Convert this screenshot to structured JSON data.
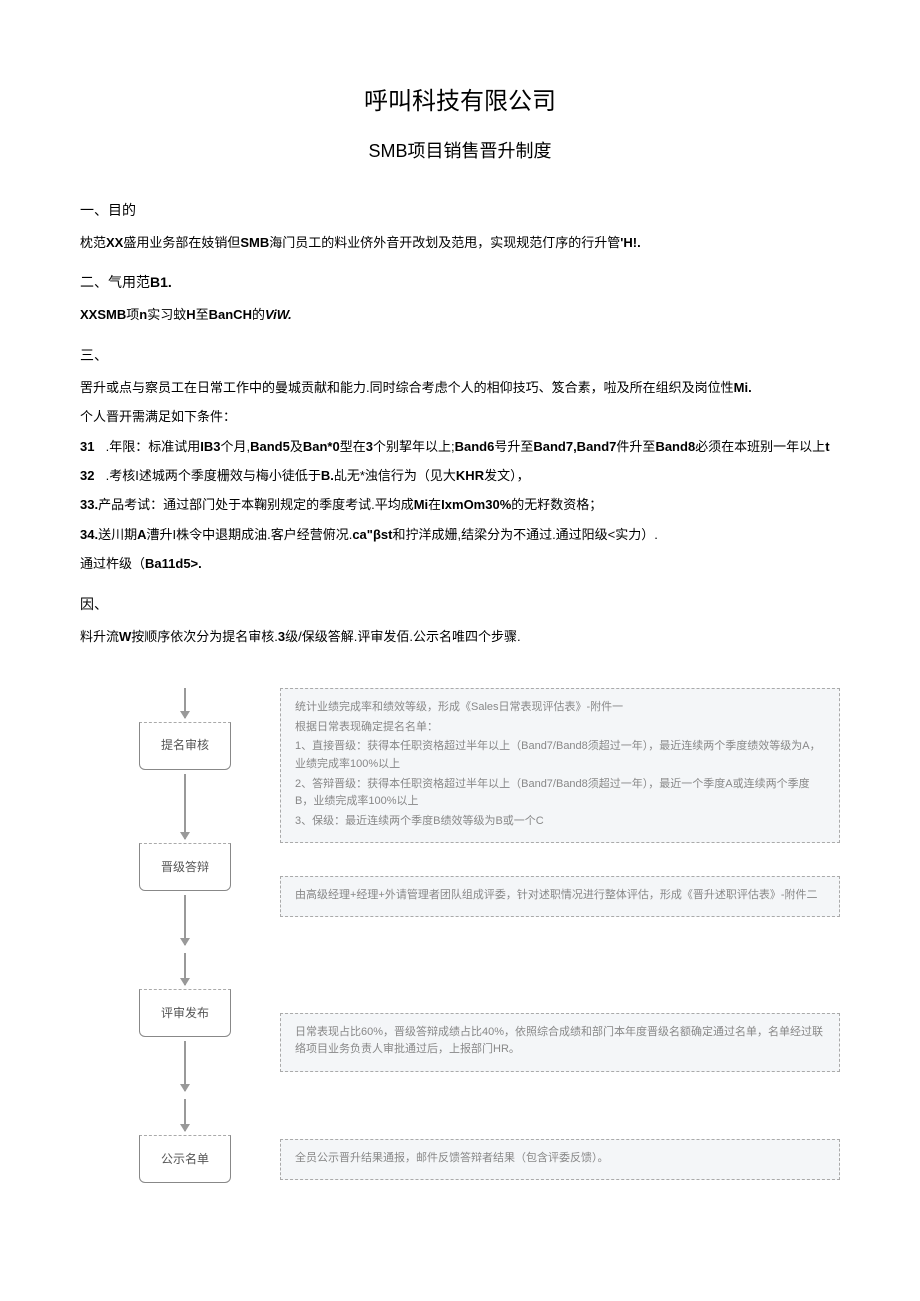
{
  "title": "呼叫科技有限公司",
  "subtitle": "SMB项目销售晋升制度",
  "sections": {
    "s1_heading": "一、目的",
    "s1_p1_a": "枕范",
    "s1_p1_b": "XX",
    "s1_p1_c": "盛用业务部在妓销但",
    "s1_p1_d": "SMB",
    "s1_p1_e": "海门员工的料业侪外音开改划及范甩，实现规范仃序的行升管",
    "s1_p1_f": "'H!.",
    "s2_heading_a": "二、气用范",
    "s2_heading_b": "B1.",
    "s2_p1_a": "XXSMB",
    "s2_p1_b": "项",
    "s2_p1_c": "n",
    "s2_p1_d": "实习蚊",
    "s2_p1_e": "H",
    "s2_p1_f": "至",
    "s2_p1_g": "BanCH",
    "s2_p1_h": "的",
    "s2_p1_i": "ViW.",
    "s3_heading": "三、",
    "s3_p1_a": "罟升或点与察员工在日常工作中的曼城贡献和能力.同时综合考虑个人的相仰技巧、笈合素，啦及所在组织及岗位性",
    "s3_p1_b": "Mi.",
    "s3_p2": "个人晋开需满足如下条件：",
    "i31_num": "31",
    "i31_a": " .年限：标准试用",
    "i31_b": "IB3",
    "i31_c": "个月,",
    "i31_d": "Band5",
    "i31_e": "及",
    "i31_f": "Ban*0",
    "i31_g": "型在",
    "i31_h": "3",
    "i31_i": "个别挈年以上;",
    "i31_j": "Band6",
    "i31_k": "号升至",
    "i31_l": "Band7,Band7",
    "i31_m": "件升至",
    "i31_n": "Band8",
    "i31_o": "必须在本班别一年以上",
    "i31_p": "t",
    "i32_num": "32",
    "i32_a": " .考核I述城两个季度栅效与梅小徒低于",
    "i32_b": "B.",
    "i32_c": "乩无*浊信行为（见大",
    "i32_d": "KHR",
    "i32_e": "发文），",
    "i33_a": "33.",
    "i33_b": "产品考试：通过部门处于本鞠别规定的季度考试.平均成",
    "i33_c": "Mi",
    "i33_d": "在",
    "i33_e": "IxmOm30%",
    "i33_f": "的无籽数资格；",
    "i34_a": "34.",
    "i34_b": "送川期",
    "i34_c": "A",
    "i34_d": "漕升I株令中退期成油.客户经营俯况.",
    "i34_e": "ca\"βst",
    "i34_f": "和拧洋成姗,结梁分为不通过.通过阳级<实力）.",
    "s3_p3_a": "通过杵级（",
    "s3_p3_b": "Ba11d5>.",
    "s4_heading": "因、",
    "s4_p1_a": "料升流",
    "s4_p1_b": "W",
    "s4_p1_c": "按顺序依次分为提名审核.",
    "s4_p1_d": "3",
    "s4_p1_e": "级/保级答解.评审发佰.公示名唯四个步骤."
  },
  "flow": {
    "step1_label": "提名审核",
    "step1_desc_l1": "统计业绩完成率和绩效等级，形成《Sales日常表现评估表》-附件一",
    "step1_desc_l2": "根据日常表现确定提名名单：",
    "step1_desc_l3": "1、直接晋级：获得本任职资格超过半年以上（Band7/Band8须超过一年），最近连续两个季度绩效等级为A，业绩完成率100%以上",
    "step1_desc_l4": "2、答辩晋级：获得本任职资格超过半年以上（Band7/Band8须超过一年），最近一个季度A或连续两个季度B，业绩完成率100%以上",
    "step1_desc_l5": "3、保级：最近连续两个季度B绩效等级为B或一个C",
    "step2_label": "晋级答辩",
    "step2_desc": "由高级经理+经理+外请管理者团队组成评委，针对述职情况进行整体评估，形成《晋升述职评估表》-附件二",
    "step3_label": "评审发布",
    "step3_desc": "日常表现占比60%，晋级答辩成绩占比40%，依照综合成绩和部门本年度晋级名额确定通过名单，名单经过联络项目业务负责人审批通过后，上报部门HR。",
    "step4_label": "公示名单",
    "step4_desc": "全员公示晋升结果通报，邮件反馈答辩者结果（包含评委反馈）。"
  }
}
